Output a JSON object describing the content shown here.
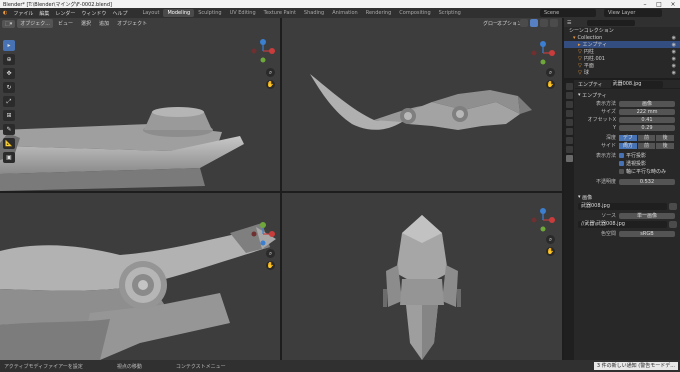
{
  "window": {
    "title": "Blender* [T:\\Blender\\マイング\\F-0002.blend]"
  },
  "topmenu": {
    "items": [
      "ファイル",
      "編集",
      "レンダー",
      "ウィンドウ",
      "ヘルプ"
    ],
    "workspaces": [
      "Layout",
      "Modeling",
      "Sculpting",
      "UV Editing",
      "Texture Paint",
      "Shading",
      "Animation",
      "Rendering",
      "Compositing",
      "Scripting"
    ],
    "active_workspace": "Modeling",
    "scene": "Scene",
    "view_layer": "View Layer"
  },
  "viewport_tl": {
    "mode": "オブジェク...",
    "menus": [
      "ビュー",
      "選択",
      "追加",
      "オブジェクト"
    ]
  },
  "viewport_tr": {
    "menus": [
      "グロー..."
    ],
    "overlay": "オプション"
  },
  "outliner": {
    "title": "シーンコレクション",
    "rows": [
      {
        "label": "Collection",
        "indent": 0,
        "selected": false
      },
      {
        "label": "エンプティ",
        "indent": 1,
        "selected": true
      },
      {
        "label": "円柱",
        "indent": 1,
        "selected": false
      },
      {
        "label": "円柱.001",
        "indent": 1,
        "selected": false
      },
      {
        "label": "平面",
        "indent": 1,
        "selected": false
      },
      {
        "label": "球",
        "indent": 1,
        "selected": false
      }
    ]
  },
  "properties": {
    "object_name_label": "エンプティ",
    "image_name": "武器008.jpg",
    "section_empty": "エンプティ",
    "display_as_label": "表示方法",
    "display_as_value": "画像",
    "size_label": "サイズ",
    "size_value": "222 mm",
    "offset_x_label": "オフセットX",
    "offset_x_value": "0.41",
    "offset_y_label": "Y",
    "offset_y_value": "0.29",
    "depth_label": "深度",
    "depth_options": [
      "デフォ...",
      "前",
      "後"
    ],
    "side_label": "サイド",
    "side_options": [
      "両方",
      "前",
      "後"
    ],
    "show_label": "表示方法",
    "show_options": [
      "平行投影",
      "透視投影",
      "軸に平行な時のみ"
    ],
    "opacity_label": "不透明度",
    "opacity_value": "0.532",
    "section_image": "画像",
    "image_field": "武器008.jpg",
    "source_label": "ソース",
    "source_value": "単一画像",
    "path_value": "//武器\\武器008.jpg",
    "colorspace_label": "色空間",
    "colorspace_value": "sRGB"
  },
  "status": {
    "items": [
      "アクティブモディファイアーを設定",
      "視点の移動",
      "コンテクストメニュー"
    ],
    "notice": "3 件の新しい通知 (警告モードデ..."
  },
  "colors": {
    "accent": "#4772b3",
    "selection": "#334d80",
    "axis_x": "#c93c3c",
    "axis_y": "#6ea83b",
    "axis_z": "#3b7fd1"
  }
}
